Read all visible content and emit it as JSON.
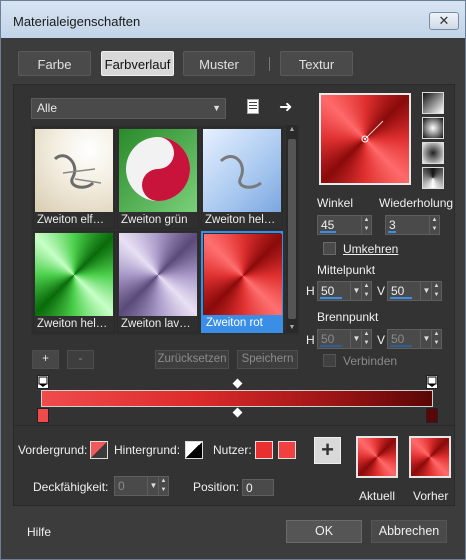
{
  "window": {
    "title": "Materialeigenschaften",
    "close_glyph": "✕"
  },
  "tabs": [
    {
      "label": "Farbe",
      "active": false
    },
    {
      "label": "Farbverlauf",
      "active": true
    },
    {
      "label": "Muster",
      "active": false
    },
    {
      "label": "Textur",
      "active": false
    }
  ],
  "gallery": {
    "category": "Alle",
    "items": [
      {
        "label": "Zweiton elf…",
        "selected": false
      },
      {
        "label": "Zweiton grün",
        "selected": false
      },
      {
        "label": "Zweiton hel…",
        "selected": false
      },
      {
        "label": "Zweiton hel…",
        "selected": false
      },
      {
        "label": "Zweiton lav…",
        "selected": false
      },
      {
        "label": "Zweiton rot",
        "selected": true
      }
    ],
    "buttons": {
      "add": "+",
      "remove": "-",
      "reset": "Zurücksetzen",
      "save": "Speichern"
    }
  },
  "settings": {
    "winkel_label": "Winkel",
    "winkel_value": "45",
    "wiederholung_label": "Wiederholung",
    "wiederholung_value": "3",
    "umkehren_label": "Umkehren",
    "umkehren_checked": false,
    "mittelpunkt_label": "Mittelpunkt",
    "mittelpunkt_h_label": "H",
    "mittelpunkt_h": "50",
    "mittelpunkt_v_label": "V",
    "mittelpunkt_v": "50",
    "brennpunkt_label": "Brennpunkt",
    "brennpunkt_h_label": "H",
    "brennpunkt_h": "50",
    "brennpunkt_v_label": "V",
    "brennpunkt_v": "50",
    "verbinden_label": "Verbinden",
    "verbinden_checked": false
  },
  "bottom": {
    "vordergrund_label": "Vordergrund:",
    "hintergrund_label": "Hintergrund:",
    "nutzer_label": "Nutzer:",
    "deckfaehigkeit_label": "Deckfähigkeit:",
    "deckfaehigkeit_value": "0",
    "position_label": "Position:",
    "position_value": "0",
    "aktuell_label": "Aktuell",
    "vorher_label": "Vorher",
    "add_glyph": "+"
  },
  "footer": {
    "help": "Hilfe",
    "ok": "OK",
    "cancel": "Abbrechen"
  },
  "colors": {
    "gradient_start": "#f04b4b",
    "gradient_end": "#5a0606",
    "selection": "#3a8ee6",
    "user_color": "#e83030"
  },
  "icons": [
    "document-icon",
    "arrow-right-icon",
    "chevron-down-icon",
    "spin-arrows-icon",
    "plus-icon",
    "close-icon"
  ]
}
